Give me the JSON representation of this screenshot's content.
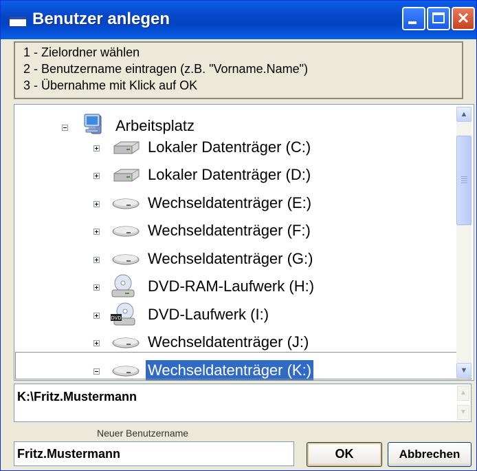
{
  "window": {
    "title": "Benutzer anlegen"
  },
  "titlebar": {
    "minimize_label": "_",
    "maximize_label": "□",
    "close_label": "✕"
  },
  "instructions": [
    "1 - Zielordner wählen",
    "2 - Benutzername eintragen (z.B. \"Vorname.Name\")",
    "3 - Übernahme mit Klick auf OK"
  ],
  "tree": {
    "root": {
      "label": "Arbeitsplatz",
      "icon": "computer-icon",
      "expanded": true
    },
    "items": [
      {
        "label": "Lokaler Datenträger (C:)",
        "icon": "hard-drive-icon",
        "expanded": false
      },
      {
        "label": "Lokaler Datenträger (D:)",
        "icon": "hard-drive-icon",
        "expanded": false
      },
      {
        "label": "Wechseldatenträger (E:)",
        "icon": "removable-drive-icon",
        "expanded": false
      },
      {
        "label": "Wechseldatenträger (F:)",
        "icon": "removable-drive-icon",
        "expanded": false
      },
      {
        "label": "Wechseldatenträger (G:)",
        "icon": "removable-drive-icon",
        "expanded": false
      },
      {
        "label": "DVD-RAM-Laufwerk (H:)",
        "icon": "dvd-ram-drive-icon",
        "expanded": false
      },
      {
        "label": "DVD-Laufwerk (I:)",
        "icon": "dvd-drive-icon",
        "expanded": false
      },
      {
        "label": "Wechseldatenträger (J:)",
        "icon": "removable-drive-icon",
        "expanded": false
      },
      {
        "label": "Wechseldatenträger (K:)",
        "icon": "removable-drive-icon",
        "expanded": true,
        "selected": true
      }
    ]
  },
  "path": {
    "value": "K:\\Fritz.Mustermann"
  },
  "new_user": {
    "label": "Neuer Benutzername",
    "value": "Fritz.Mustermann"
  },
  "buttons": {
    "ok": "OK",
    "cancel": "Abbrechen"
  },
  "colors": {
    "title_blue": "#0a5fe8",
    "selection": "#316ac5",
    "face": "#ece9d8"
  }
}
